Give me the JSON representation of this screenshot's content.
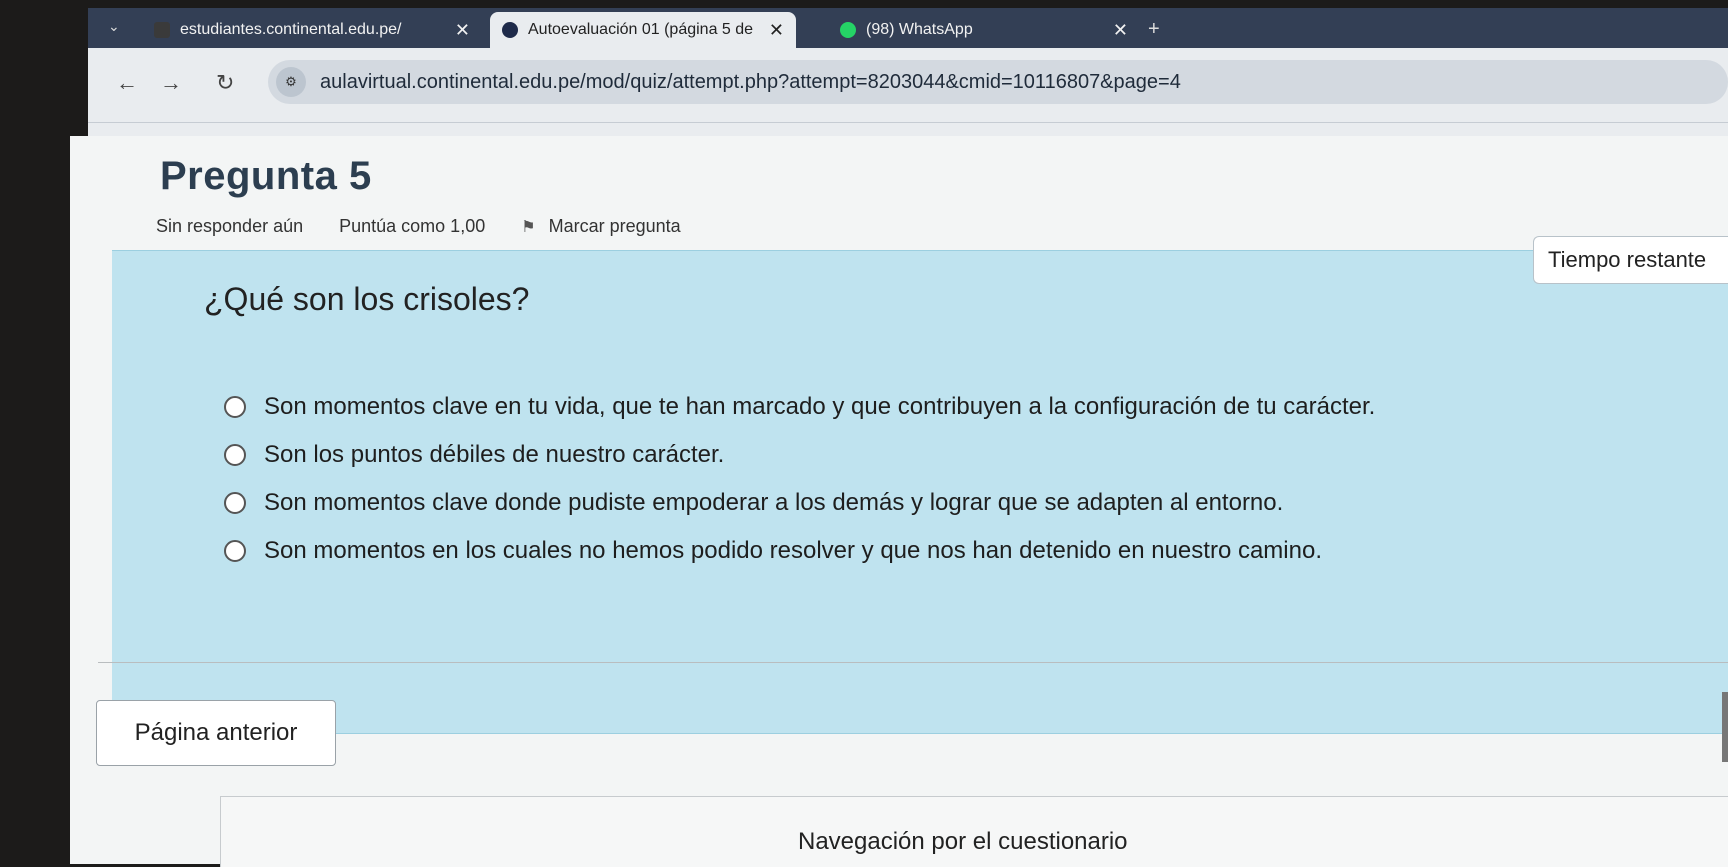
{
  "browser": {
    "tabs": [
      {
        "title": "estudiantes.continental.edu.pe/",
        "active": false,
        "favicon_color": "#3a3a3a",
        "close": "✕"
      },
      {
        "title": "Autoevaluación 01 (página 5 de",
        "active": true,
        "favicon_color": "#1e2a4a",
        "close": "✕"
      },
      {
        "title": "(98) WhatsApp",
        "active": false,
        "favicon_color": "#25d366",
        "close": "✕"
      }
    ],
    "new_tab": "+",
    "tab_dropdown": "⌄",
    "back": "←",
    "forward": "→",
    "reload": "↻",
    "site_info_icon": "⚙",
    "url": "aulavirtual.continental.edu.pe/mod/quiz/attempt.php?attempt=8203044&cmid=10116807&page=4"
  },
  "question": {
    "title": "Pregunta 5",
    "status": "Sin responder aún",
    "score": "Puntúa como 1,00",
    "flag_label": "Marcar pregunta",
    "text": "¿Qué son los crisoles?",
    "answers": [
      "Son momentos clave en tu vida, que te han marcado y que contribuyen a la configuración de tu carácter.",
      "Son los puntos débiles de nuestro carácter.",
      "Son momentos clave donde pudiste empoderar a los demás y lograr que se adapten al entorno.",
      "Son momentos en los cuales no hemos podido resolver y que nos han detenido en nuestro camino."
    ]
  },
  "timer": {
    "label": "Tiempo restante"
  },
  "footer": {
    "prev_button": "Página anterior",
    "nav_title": "Navegación por el cuestionario"
  }
}
